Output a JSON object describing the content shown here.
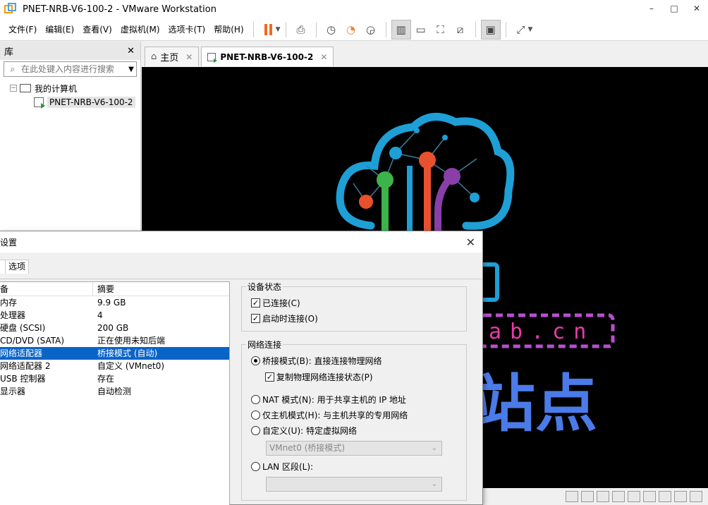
{
  "window": {
    "title": "PNET-NRB-V6-100-2 - VMware Workstation",
    "controls": [
      "–",
      "□",
      "✕"
    ]
  },
  "menu": [
    "文件(F)",
    "编辑(E)",
    "查看(V)",
    "虚拟机(M)",
    "选项卡(T)",
    "帮助(H)"
  ],
  "library": {
    "title": "库",
    "close": "✕",
    "search_placeholder": "在此处键入内容进行搜索",
    "root": "我的计算机",
    "vm": "PNET-NRB-V6-100-2"
  },
  "tabs": [
    {
      "label": "主页",
      "close": "✕"
    },
    {
      "label": "PNET-NRB-V6-100-2",
      "close": "✕"
    }
  ],
  "vm_screen": {
    "text_domain": "ab.cn",
    "text_cn": "站点"
  },
  "dialog": {
    "title": "设置",
    "close": "✕",
    "tab_options": "选项",
    "columns": {
      "device": "备",
      "summary": "摘要"
    },
    "devices": [
      {
        "name": "内存",
        "summary": "9.9 GB"
      },
      {
        "name": "处理器",
        "summary": "4"
      },
      {
        "name": "硬盘 (SCSI)",
        "summary": "200 GB"
      },
      {
        "name": "CD/DVD (SATA)",
        "summary": "正在使用未知后端"
      },
      {
        "name": "网络适配器",
        "summary": "桥接模式 (自动)"
      },
      {
        "name": "网络适配器 2",
        "summary": "自定义 (VMnet0)"
      },
      {
        "name": "USB 控制器",
        "summary": "存在"
      },
      {
        "name": "显示器",
        "summary": "自动检测"
      }
    ],
    "device_status": {
      "title": "设备状态",
      "connected": "已连接(C)",
      "connect_on_start": "启动时连接(O)"
    },
    "network": {
      "title": "网络连接",
      "bridged": "桥接模式(B): 直接连接物理网络",
      "replicate": "复制物理网络连接状态(P)",
      "nat": "NAT 模式(N): 用于共享主机的 IP 地址",
      "host_only": "仅主机模式(H): 与主机共享的专用网络",
      "custom": "自定义(U): 特定虚拟网络",
      "custom_value": "VMnet0 (桥接模式)",
      "lan": "LAN 区段(L):",
      "lan_value": ""
    }
  }
}
